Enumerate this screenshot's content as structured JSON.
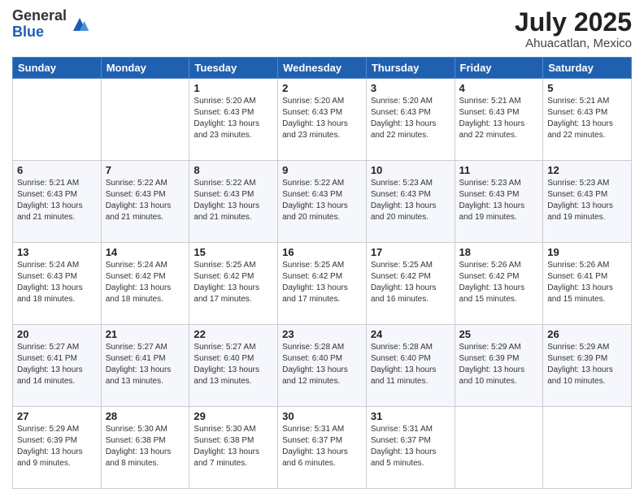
{
  "logo": {
    "general": "General",
    "blue": "Blue"
  },
  "title": "July 2025",
  "location": "Ahuacatlan, Mexico",
  "days_of_week": [
    "Sunday",
    "Monday",
    "Tuesday",
    "Wednesday",
    "Thursday",
    "Friday",
    "Saturday"
  ],
  "weeks": [
    [
      {
        "day": "",
        "sunrise": "",
        "sunset": "",
        "daylight": ""
      },
      {
        "day": "",
        "sunrise": "",
        "sunset": "",
        "daylight": ""
      },
      {
        "day": "1",
        "sunrise": "Sunrise: 5:20 AM",
        "sunset": "Sunset: 6:43 PM",
        "daylight": "Daylight: 13 hours and 23 minutes."
      },
      {
        "day": "2",
        "sunrise": "Sunrise: 5:20 AM",
        "sunset": "Sunset: 6:43 PM",
        "daylight": "Daylight: 13 hours and 23 minutes."
      },
      {
        "day": "3",
        "sunrise": "Sunrise: 5:20 AM",
        "sunset": "Sunset: 6:43 PM",
        "daylight": "Daylight: 13 hours and 22 minutes."
      },
      {
        "day": "4",
        "sunrise": "Sunrise: 5:21 AM",
        "sunset": "Sunset: 6:43 PM",
        "daylight": "Daylight: 13 hours and 22 minutes."
      },
      {
        "day": "5",
        "sunrise": "Sunrise: 5:21 AM",
        "sunset": "Sunset: 6:43 PM",
        "daylight": "Daylight: 13 hours and 22 minutes."
      }
    ],
    [
      {
        "day": "6",
        "sunrise": "Sunrise: 5:21 AM",
        "sunset": "Sunset: 6:43 PM",
        "daylight": "Daylight: 13 hours and 21 minutes."
      },
      {
        "day": "7",
        "sunrise": "Sunrise: 5:22 AM",
        "sunset": "Sunset: 6:43 PM",
        "daylight": "Daylight: 13 hours and 21 minutes."
      },
      {
        "day": "8",
        "sunrise": "Sunrise: 5:22 AM",
        "sunset": "Sunset: 6:43 PM",
        "daylight": "Daylight: 13 hours and 21 minutes."
      },
      {
        "day": "9",
        "sunrise": "Sunrise: 5:22 AM",
        "sunset": "Sunset: 6:43 PM",
        "daylight": "Daylight: 13 hours and 20 minutes."
      },
      {
        "day": "10",
        "sunrise": "Sunrise: 5:23 AM",
        "sunset": "Sunset: 6:43 PM",
        "daylight": "Daylight: 13 hours and 20 minutes."
      },
      {
        "day": "11",
        "sunrise": "Sunrise: 5:23 AM",
        "sunset": "Sunset: 6:43 PM",
        "daylight": "Daylight: 13 hours and 19 minutes."
      },
      {
        "day": "12",
        "sunrise": "Sunrise: 5:23 AM",
        "sunset": "Sunset: 6:43 PM",
        "daylight": "Daylight: 13 hours and 19 minutes."
      }
    ],
    [
      {
        "day": "13",
        "sunrise": "Sunrise: 5:24 AM",
        "sunset": "Sunset: 6:43 PM",
        "daylight": "Daylight: 13 hours and 18 minutes."
      },
      {
        "day": "14",
        "sunrise": "Sunrise: 5:24 AM",
        "sunset": "Sunset: 6:42 PM",
        "daylight": "Daylight: 13 hours and 18 minutes."
      },
      {
        "day": "15",
        "sunrise": "Sunrise: 5:25 AM",
        "sunset": "Sunset: 6:42 PM",
        "daylight": "Daylight: 13 hours and 17 minutes."
      },
      {
        "day": "16",
        "sunrise": "Sunrise: 5:25 AM",
        "sunset": "Sunset: 6:42 PM",
        "daylight": "Daylight: 13 hours and 17 minutes."
      },
      {
        "day": "17",
        "sunrise": "Sunrise: 5:25 AM",
        "sunset": "Sunset: 6:42 PM",
        "daylight": "Daylight: 13 hours and 16 minutes."
      },
      {
        "day": "18",
        "sunrise": "Sunrise: 5:26 AM",
        "sunset": "Sunset: 6:42 PM",
        "daylight": "Daylight: 13 hours and 15 minutes."
      },
      {
        "day": "19",
        "sunrise": "Sunrise: 5:26 AM",
        "sunset": "Sunset: 6:41 PM",
        "daylight": "Daylight: 13 hours and 15 minutes."
      }
    ],
    [
      {
        "day": "20",
        "sunrise": "Sunrise: 5:27 AM",
        "sunset": "Sunset: 6:41 PM",
        "daylight": "Daylight: 13 hours and 14 minutes."
      },
      {
        "day": "21",
        "sunrise": "Sunrise: 5:27 AM",
        "sunset": "Sunset: 6:41 PM",
        "daylight": "Daylight: 13 hours and 13 minutes."
      },
      {
        "day": "22",
        "sunrise": "Sunrise: 5:27 AM",
        "sunset": "Sunset: 6:40 PM",
        "daylight": "Daylight: 13 hours and 13 minutes."
      },
      {
        "day": "23",
        "sunrise": "Sunrise: 5:28 AM",
        "sunset": "Sunset: 6:40 PM",
        "daylight": "Daylight: 13 hours and 12 minutes."
      },
      {
        "day": "24",
        "sunrise": "Sunrise: 5:28 AM",
        "sunset": "Sunset: 6:40 PM",
        "daylight": "Daylight: 13 hours and 11 minutes."
      },
      {
        "day": "25",
        "sunrise": "Sunrise: 5:29 AM",
        "sunset": "Sunset: 6:39 PM",
        "daylight": "Daylight: 13 hours and 10 minutes."
      },
      {
        "day": "26",
        "sunrise": "Sunrise: 5:29 AM",
        "sunset": "Sunset: 6:39 PM",
        "daylight": "Daylight: 13 hours and 10 minutes."
      }
    ],
    [
      {
        "day": "27",
        "sunrise": "Sunrise: 5:29 AM",
        "sunset": "Sunset: 6:39 PM",
        "daylight": "Daylight: 13 hours and 9 minutes."
      },
      {
        "day": "28",
        "sunrise": "Sunrise: 5:30 AM",
        "sunset": "Sunset: 6:38 PM",
        "daylight": "Daylight: 13 hours and 8 minutes."
      },
      {
        "day": "29",
        "sunrise": "Sunrise: 5:30 AM",
        "sunset": "Sunset: 6:38 PM",
        "daylight": "Daylight: 13 hours and 7 minutes."
      },
      {
        "day": "30",
        "sunrise": "Sunrise: 5:31 AM",
        "sunset": "Sunset: 6:37 PM",
        "daylight": "Daylight: 13 hours and 6 minutes."
      },
      {
        "day": "31",
        "sunrise": "Sunrise: 5:31 AM",
        "sunset": "Sunset: 6:37 PM",
        "daylight": "Daylight: 13 hours and 5 minutes."
      },
      {
        "day": "",
        "sunrise": "",
        "sunset": "",
        "daylight": ""
      },
      {
        "day": "",
        "sunrise": "",
        "sunset": "",
        "daylight": ""
      }
    ]
  ]
}
